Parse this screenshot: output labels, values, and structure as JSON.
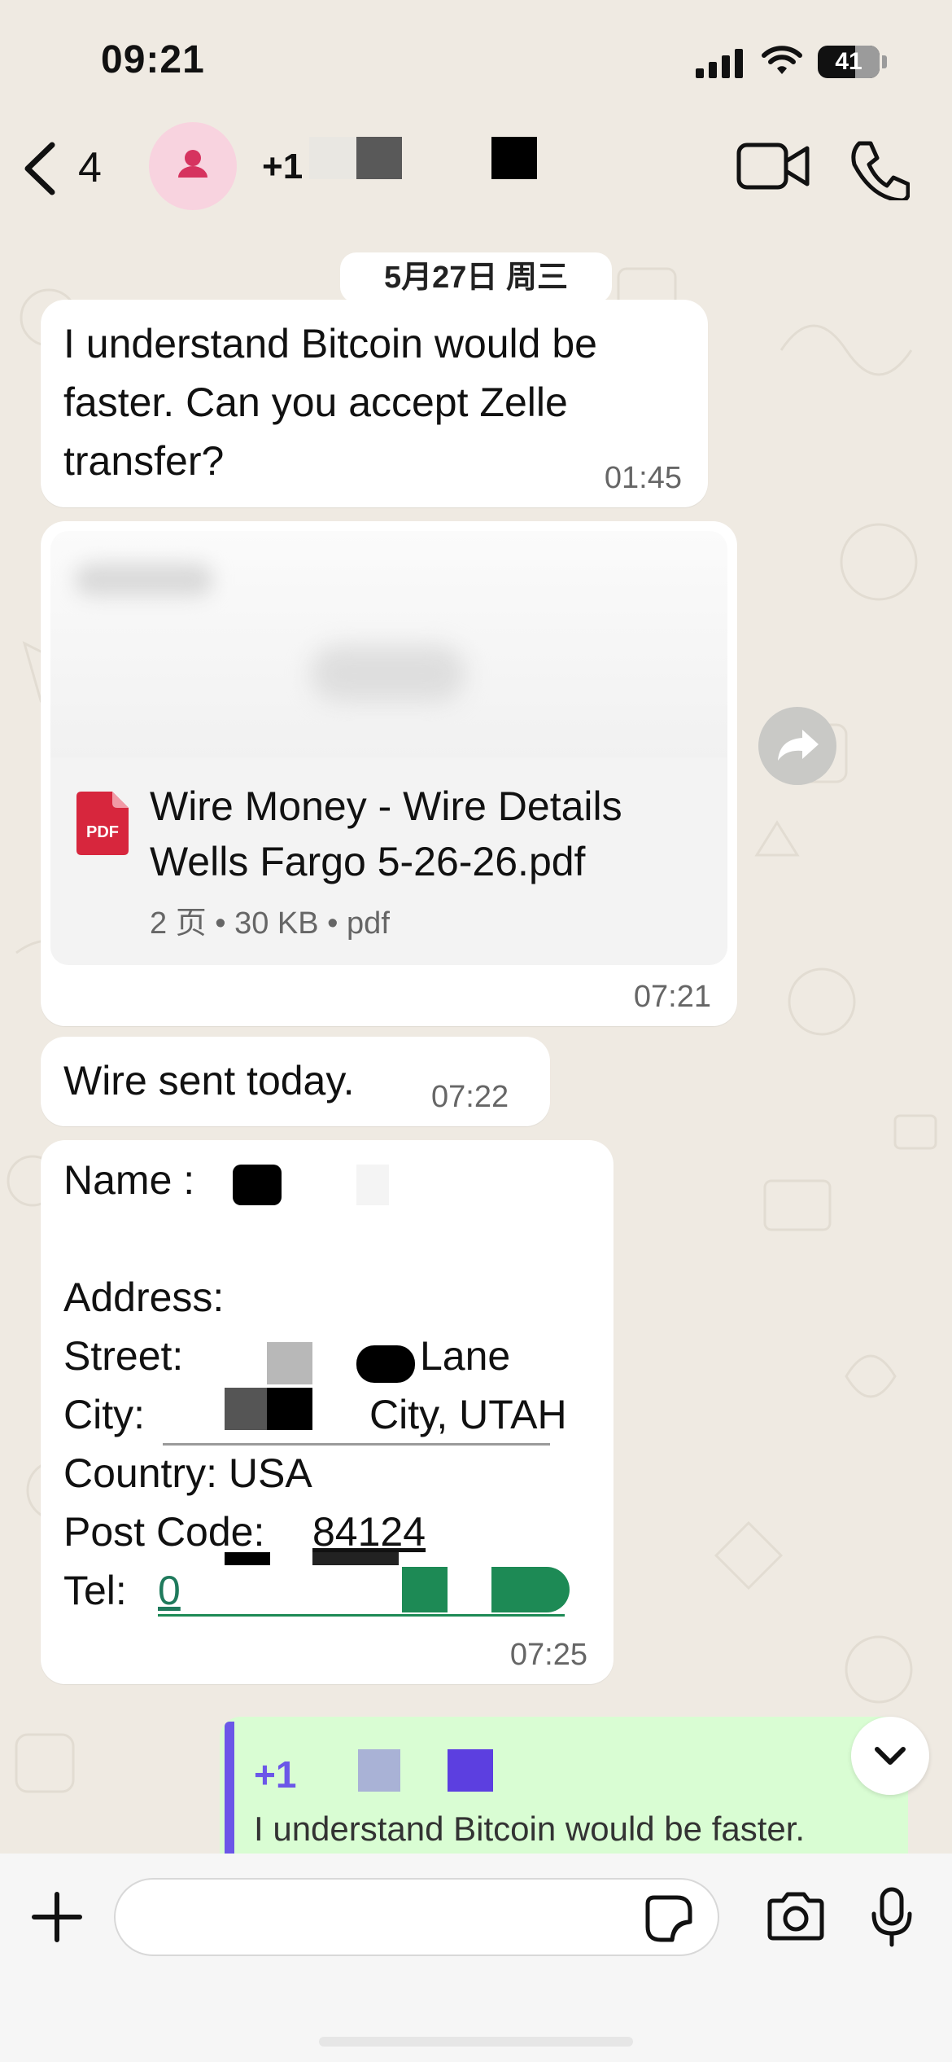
{
  "status_bar": {
    "time": "09:21",
    "battery": "41"
  },
  "header": {
    "unread_count": "4",
    "contact_prefix": "+1"
  },
  "chat": {
    "date_chip": "5月27日 周三",
    "messages": [
      {
        "text": "I understand Bitcoin would be faster.  Can you accept Zelle transfer?",
        "time": "01:45"
      },
      {
        "doc_name": "Wire Money - Wire Details Wells Fargo 5-26-26.pdf",
        "doc_badge": "PDF",
        "doc_meta": "2 页 • 30 KB • pdf",
        "time": "07:21"
      },
      {
        "text": "Wire sent today.",
        "time": "07:22"
      },
      {
        "name_label": "Name :",
        "address_label": "Address:",
        "street_label": "Street:",
        "street_suffix": "Lane",
        "city_label": "City:",
        "city_suffix": "City, UTAH",
        "country_line": "Country: USA",
        "post_label": "Post Code:",
        "post_value": "84124",
        "tel_label": "Tel:",
        "tel_value": "0",
        "time": "07:25"
      }
    ],
    "reply_preview": {
      "name": "+1",
      "text": "I understand Bitcoin would be faster."
    }
  },
  "composer": {
    "placeholder": ""
  }
}
